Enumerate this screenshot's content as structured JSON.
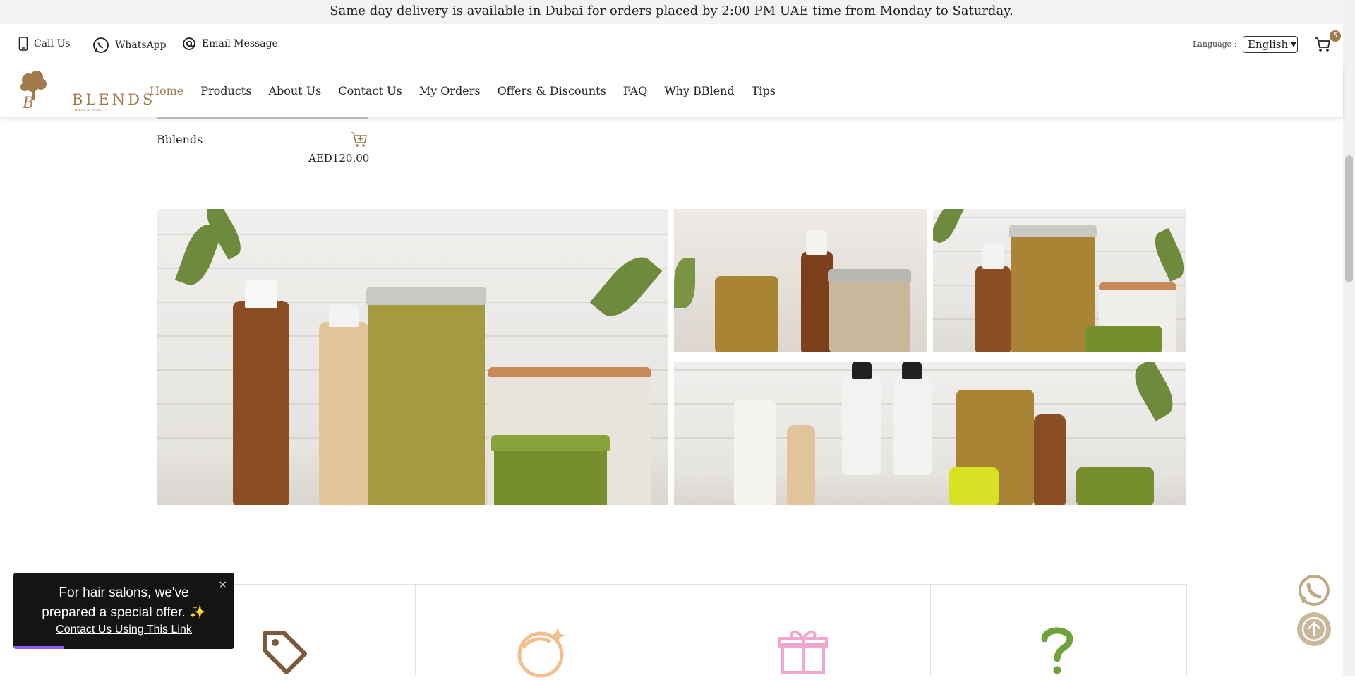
{
  "announcement": "Same day delivery is available in Dubai for orders placed by 2:00 PM UAE time from Monday to Saturday.",
  "contact": {
    "call_label": "Call Us",
    "whatsapp_label": "WhatsApp",
    "email_label": "Email Message"
  },
  "language": {
    "label": "Language :",
    "selected": "English"
  },
  "cart": {
    "count": "5"
  },
  "logo": {
    "text": "BLENDS",
    "sub": "HAIR & BEAUTY"
  },
  "nav": {
    "items": [
      {
        "label": "Home",
        "active": true
      },
      {
        "label": "Products"
      },
      {
        "label": "About Us"
      },
      {
        "label": "Contact Us"
      },
      {
        "label": "My Orders"
      },
      {
        "label": "Offers & Discounts"
      },
      {
        "label": "FAQ"
      },
      {
        "label": "Why BBlend"
      },
      {
        "label": "Tips"
      }
    ]
  },
  "product": {
    "name": "Bblends",
    "price": "AED120.00"
  },
  "toast": {
    "line1": "For hair salons, we've",
    "line2": "prepared a special offer. ✨",
    "link": "Contact Us Using This Link",
    "close": "×",
    "progress": 0.23
  },
  "features": {
    "icons": [
      "tag-icon",
      "child-face-icon",
      "gift-icon",
      "question-icon"
    ]
  },
  "colors": {
    "accent": "#a07a4a",
    "toast_bg": "#141414",
    "progress": "#8a5cf5"
  }
}
